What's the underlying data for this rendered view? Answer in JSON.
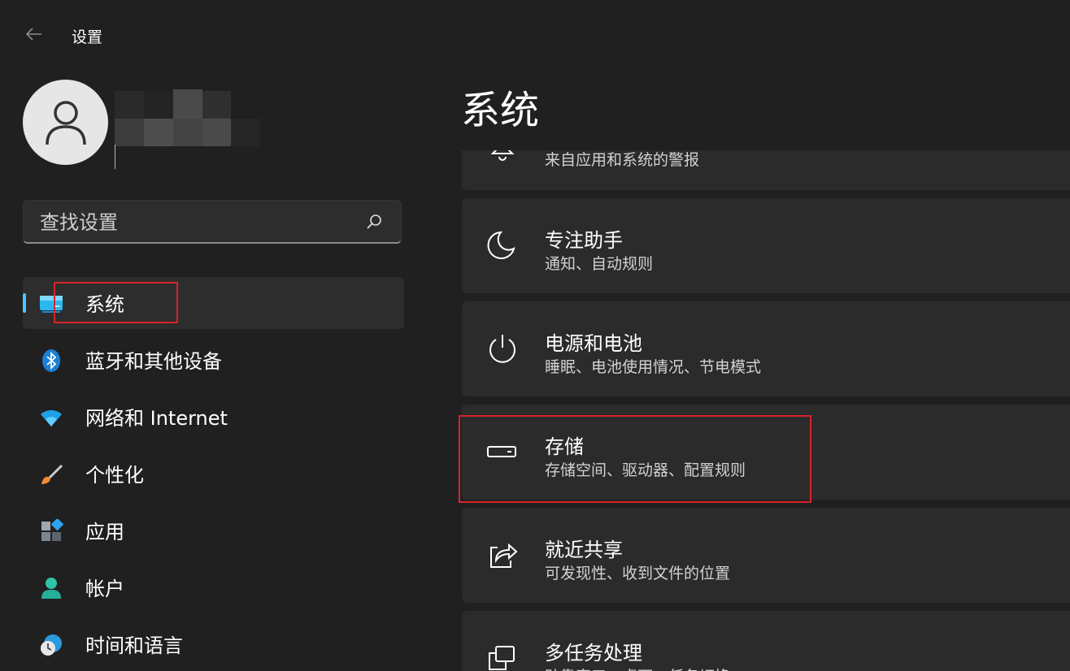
{
  "window": {
    "title": "设置",
    "back_icon": "back-arrow-icon"
  },
  "profile": {
    "avatar_icon": "person-icon",
    "name": ""
  },
  "search": {
    "placeholder": "查找设置",
    "icon": "search-icon"
  },
  "nav": {
    "items": [
      {
        "label": "系统",
        "icon": "system-monitor-icon",
        "selected": true
      },
      {
        "label": "蓝牙和其他设备",
        "icon": "bluetooth-icon"
      },
      {
        "label": "网络和 Internet",
        "icon": "wifi-icon"
      },
      {
        "label": "个性化",
        "icon": "brush-icon"
      },
      {
        "label": "应用",
        "icon": "apps-icon"
      },
      {
        "label": "帐户",
        "icon": "account-icon"
      },
      {
        "label": "时间和语言",
        "icon": "clock-globe-icon"
      }
    ]
  },
  "main": {
    "title": "系统",
    "cards": [
      {
        "title": "",
        "subtitle": "来自应用和系统的警报",
        "icon": "notification-bell-icon"
      },
      {
        "title": "专注助手",
        "subtitle": "通知、自动规则",
        "icon": "moon-icon"
      },
      {
        "title": "电源和电池",
        "subtitle": "睡眠、电池使用情况、节电模式",
        "icon": "power-icon"
      },
      {
        "title": "存储",
        "subtitle": "存储空间、驱动器、配置规则",
        "icon": "storage-drive-icon"
      },
      {
        "title": "就近共享",
        "subtitle": "可发现性、收到文件的位置",
        "icon": "share-icon"
      },
      {
        "title": "多任务处理",
        "subtitle": "贴靠窗口、桌面、任务切换",
        "icon": "multitasking-icon"
      }
    ]
  },
  "colors": {
    "background": "#202020",
    "card": "#2b2b2b",
    "accent": "#4cc2ff",
    "highlight_box": "#d8232a"
  }
}
